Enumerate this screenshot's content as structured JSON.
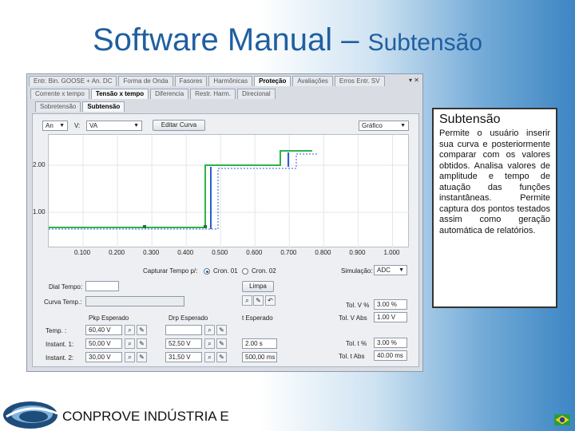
{
  "slide": {
    "title_main": "Software Manual – ",
    "title_sub": "Subtensão"
  },
  "app": {
    "tabs_row1": [
      "Entr. Bin. GOOSE + An. DC",
      "Forma de Onda",
      "Fasores",
      "Harmônicas",
      "Proteção",
      "Avaliações",
      "Erros Entr. SV"
    ],
    "tabs_row1_active": "Proteção",
    "window_controls": "▾ ✕",
    "tabs_row2": [
      "Corrente x tempo",
      "Tensão x tempo",
      "Diferencia",
      "Restr. Harm.",
      "Direcional"
    ],
    "tabs_row2_active": "Tensão x tempo",
    "tabs_row3": [
      "Sobretensão",
      "Subtensão"
    ],
    "tabs_row3_active": "Subtensão",
    "toolbar": {
      "phase_select": "An",
      "v_label": "V:",
      "v_select": "VA",
      "edit_curve_button": "Editar Curva",
      "view_select": "Gráfico"
    },
    "graph": {
      "y_ticks": [
        "2.00",
        "1.00"
      ],
      "x_ticks": [
        "0.100",
        "0.200",
        "0.300",
        "0.400",
        "0.500",
        "0.600",
        "0.700",
        "0.800",
        "0.900",
        "1.000"
      ]
    },
    "capture_label": "Capturar Tempo p/:",
    "radio1": "Cron. 01",
    "radio2": "Cron. 02",
    "simulation_label": "Simulação:",
    "simulation_select": "ADC",
    "clear_button": "Limpa",
    "dial_tempo_label": "Dial Tempo:",
    "curva_tempo_label": "Curva Temp.:",
    "tol_v_pct_label": "Tol. V %",
    "tol_v_pct_value": "3.00 %",
    "tol_v_abs_label": "Tol. V Abs",
    "tol_v_abs_value": "1.00 V",
    "tol_t_pct_label": "Tol. t %",
    "tol_t_pct_value": "3.00 %",
    "tol_t_abs_label": "Tol. t Abs",
    "tol_t_abs_value": "40.00 ms",
    "col_pickup": "Pkp Esperado",
    "col_dropout": "Drp Esperado",
    "col_time": "t Esperado",
    "rows": [
      {
        "label": "Temp. :",
        "pickup": "60,40 V",
        "dropout": "",
        "time": ""
      },
      {
        "label": "Instant. 1:",
        "pickup": "50,00 V",
        "dropout": "52,50 V",
        "time": "2.00 s"
      },
      {
        "label": "Instant. 2:",
        "pickup": "30,00 V",
        "dropout": "31,50 V",
        "time": "500,00 ms"
      }
    ]
  },
  "description": {
    "title": "Subtensão",
    "body": "Permite o usuário inserir sua curva e posteriormente comparar com os valores obtidos. Analisa valores de amplitude e tempo de atuação das funções instantâneas. Permite captura dos pontos testados assim como geração automática de relatórios."
  },
  "footer": {
    "company": "CONPROVE INDÚSTRIA E"
  },
  "colors": {
    "title": "#1f5fa0",
    "curve_green": "#2fb24a",
    "curve_blue": "#2b5fd0",
    "grid": "#e3e6ea"
  }
}
